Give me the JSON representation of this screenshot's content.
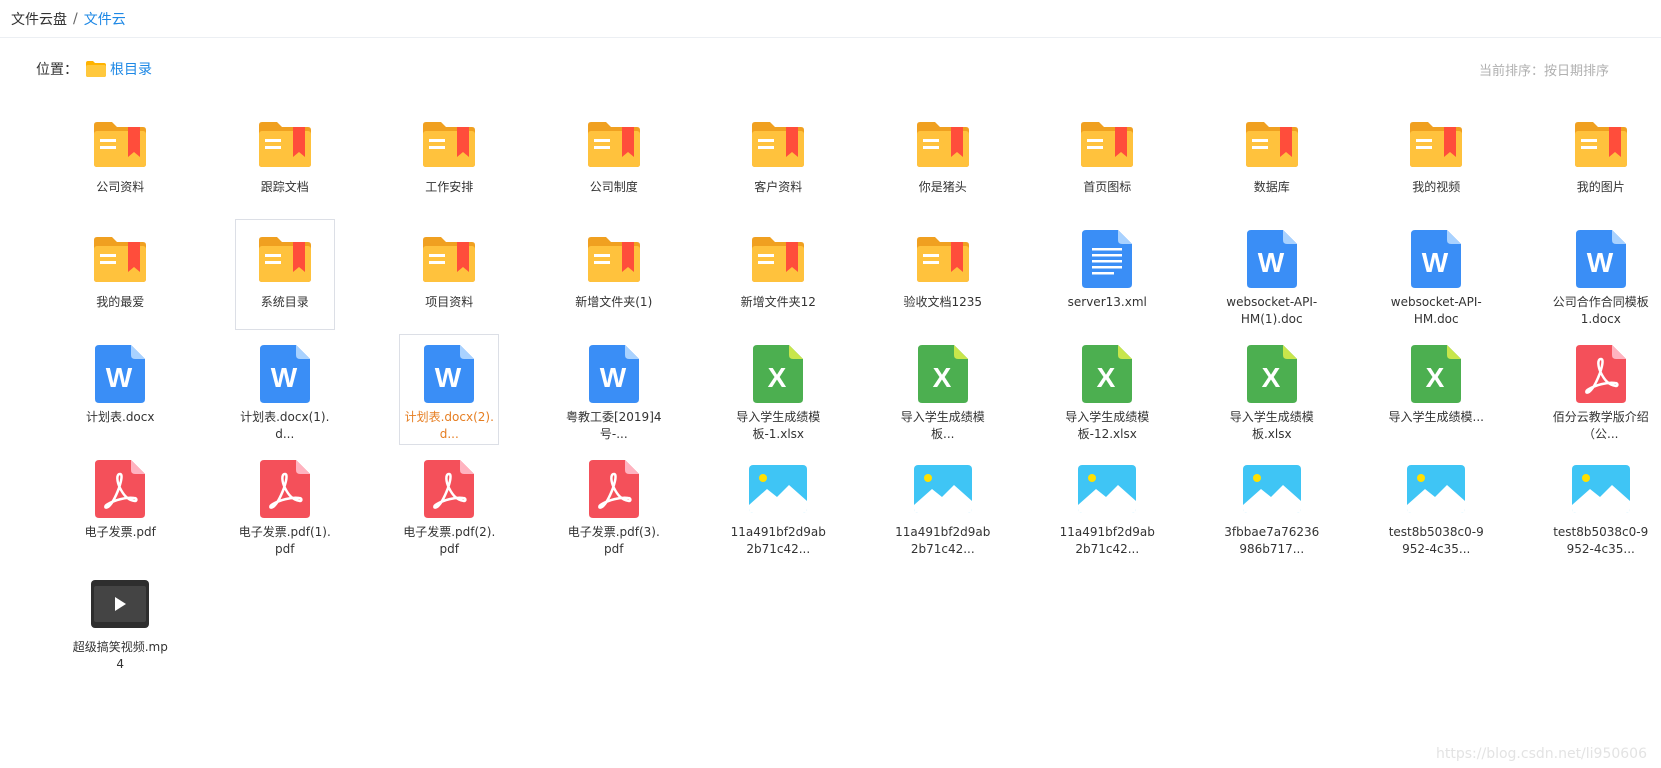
{
  "breadcrumb": {
    "root": "文件云盘",
    "separator": "/",
    "current": "文件云"
  },
  "location": {
    "label": "位置：",
    "folder": "根目录",
    "folder_icon": "folder-icon"
  },
  "sort_hint": "当前排序：按日期排序",
  "colors": {
    "folder": "#ffc23d",
    "folder_tab": "#f0a020",
    "bookmark": "#ff4d3b",
    "word": "#3a8ef6",
    "excel": "#4caf50",
    "pdf": "#f4505a",
    "image": "#3fc5f5",
    "video": "#444444",
    "link": "#1e88e5",
    "selected_text": "#e67e22"
  },
  "files": [
    {
      "name": "公司资料",
      "type": "folder"
    },
    {
      "name": "跟踪文档",
      "type": "folder"
    },
    {
      "name": "工作安排",
      "type": "folder"
    },
    {
      "name": "公司制度",
      "type": "folder"
    },
    {
      "name": "客户资料",
      "type": "folder"
    },
    {
      "name": "你是猪头",
      "type": "folder"
    },
    {
      "name": "首页图标",
      "type": "folder"
    },
    {
      "name": "数据库",
      "type": "folder"
    },
    {
      "name": "我的视频",
      "type": "folder"
    },
    {
      "name": "我的图片",
      "type": "folder"
    },
    {
      "name": "我的最爱",
      "type": "folder"
    },
    {
      "name": "系统目录",
      "type": "folder",
      "state": "hover"
    },
    {
      "name": "项目资料",
      "type": "folder"
    },
    {
      "name": "新增文件夹(1)",
      "type": "folder"
    },
    {
      "name": "新增文件夹12",
      "type": "folder"
    },
    {
      "name": "验收文档1235",
      "type": "folder"
    },
    {
      "name": "server13.xml",
      "type": "text"
    },
    {
      "name": "websocket-API-HM(1).doc",
      "type": "word"
    },
    {
      "name": "websocket-API-HM.doc",
      "type": "word"
    },
    {
      "name": "公司合作合同模板1.docx",
      "type": "word"
    },
    {
      "name": "计划表.docx",
      "type": "word"
    },
    {
      "name": "计划表.docx(1).d...",
      "type": "word"
    },
    {
      "name": "计划表.docx(2).d...",
      "type": "word",
      "state": "selected"
    },
    {
      "name": "粤教工委[2019]4号-...",
      "type": "word"
    },
    {
      "name": "导入学生成绩模板-1.xlsx",
      "type": "excel"
    },
    {
      "name": "导入学生成绩模板...",
      "type": "excel"
    },
    {
      "name": "导入学生成绩模板-12.xlsx",
      "type": "excel"
    },
    {
      "name": "导入学生成绩模板.xlsx",
      "type": "excel"
    },
    {
      "name": "导入学生成绩模...",
      "type": "excel"
    },
    {
      "name": "佰分云教学版介绍（公...",
      "type": "pdf"
    },
    {
      "name": "电子发票.pdf",
      "type": "pdf"
    },
    {
      "name": "电子发票.pdf(1).pdf",
      "type": "pdf"
    },
    {
      "name": "电子发票.pdf(2).pdf",
      "type": "pdf"
    },
    {
      "name": "电子发票.pdf(3).pdf",
      "type": "pdf"
    },
    {
      "name": "11a491bf2d9ab2b71c42...",
      "type": "image"
    },
    {
      "name": "11a491bf2d9ab2b71c42...",
      "type": "image"
    },
    {
      "name": "11a491bf2d9ab2b71c42...",
      "type": "image"
    },
    {
      "name": "3fbbae7a76236986b717...",
      "type": "image"
    },
    {
      "name": "test8b5038c0-9952-4c35...",
      "type": "image"
    },
    {
      "name": "test8b5038c0-9952-4c35...",
      "type": "image"
    },
    {
      "name": "超级搞笑视频.mp4",
      "type": "video"
    }
  ],
  "watermark": "https://blog.csdn.net/li950606"
}
